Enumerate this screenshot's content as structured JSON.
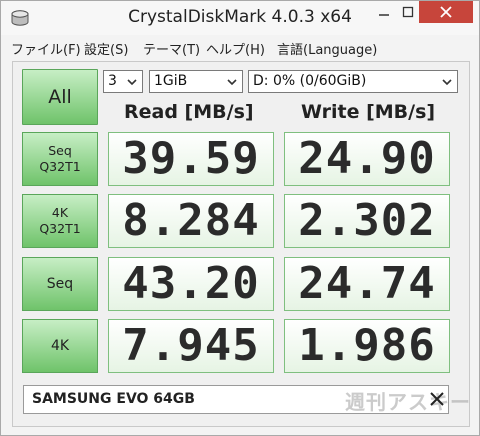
{
  "window": {
    "title": "CrystalDiskMark 4.0.3 x64"
  },
  "menu": [
    "ファイル(F)",
    "設定(S)",
    "テーマ(T)",
    "ヘルプ(H)",
    "言語(Language)"
  ],
  "controls": {
    "all_label": "All",
    "count": "3",
    "size": "1GiB",
    "drive": "D: 0% (0/60GiB)"
  },
  "headers": {
    "read": "Read [MB/s]",
    "write": "Write [MB/s]"
  },
  "rows": [
    {
      "label1": "Seq",
      "label2": "Q32T1",
      "read": "39.59",
      "write": "24.90"
    },
    {
      "label1": "4K",
      "label2": "Q32T1",
      "read": "8.284",
      "write": "2.302"
    },
    {
      "label1": "Seq",
      "label2": "",
      "read": "43.20",
      "write": "24.74"
    },
    {
      "label1": "4K",
      "label2": "",
      "read": "7.945",
      "write": "1.986"
    }
  ],
  "comment": "SAMSUNG EVO 64GB",
  "watermark": "週刊アスキー",
  "icons": {
    "app": "disk-icon",
    "minimize": "minimize-icon",
    "maximize": "maximize-icon",
    "close": "close-icon",
    "clear": "x-icon"
  },
  "colors": {
    "close_button": "#c7453b",
    "button_green": "#6fc36a",
    "cell_border": "#7fbf7f"
  }
}
